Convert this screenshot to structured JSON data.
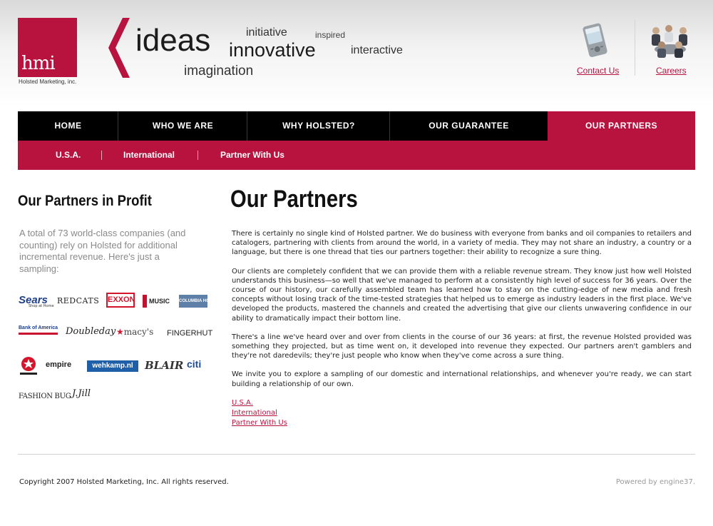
{
  "header": {
    "logo_text": "hmi",
    "logo_subtitle": "Holsted Marketing, inc.",
    "taglines": {
      "ideas": "ideas",
      "initiative": "initiative",
      "inspired": "inspired",
      "innovative": "innovative",
      "interactive": "interactive",
      "imagination": "imagination"
    },
    "contact_label": "Contact Us",
    "careers_label": "Careers"
  },
  "nav": {
    "items": [
      "HOME",
      "WHO WE ARE",
      "WHY HOLSTED?",
      "OUR GUARANTEE",
      "OUR PARTNERS"
    ],
    "active": "OUR PARTNERS"
  },
  "subnav": {
    "items": [
      "U.S.A.",
      "International",
      "Partner With Us"
    ]
  },
  "sidebar": {
    "title": "Our Partners in Profit",
    "text": "A total of 73 world-class companies (and counting) rely on Holsted for additional incremental revenue. Here's just a sampling:",
    "logos": [
      "Sears",
      "Shop at Home",
      "REDCATS",
      "EXXON",
      "MUSIC",
      "COLUMBIA HOUSE",
      "Bank of America",
      "Doubleday",
      "macy's",
      "FINGERHUT",
      "empire",
      "wehkamp.nl",
      "BLAIR",
      "citi",
      "FASHION BUG",
      "J.Jill"
    ]
  },
  "main": {
    "title": "Our Partners",
    "paragraphs": [
      "There is certainly no single kind of Holsted partner. We do business with everyone from banks and oil companies to retailers and catalogers, partnering with clients from around the world, in a variety of media. They may not share an industry, a country or a language, but there is one thread that ties our partners together: their ability to recognize a sure thing.",
      "Our clients are completely confident that we can provide them with a reliable revenue stream. They know just how well Holsted understands this business—so well that we've managed to perform at a consistently high level of success for 36 years. Over the course of our history, our carefully assembled team has learned how to stay on the cutting-edge of new media and fresh concepts without losing track of the time-tested strategies that helped us to emerge as industry leaders in the first place. We've developed the products, mastered the channels and created the advertising that give our clients unwavering confidence in our ability to dramatically impact their bottom line.",
      "There's a line we've heard over and over from clients in the course of our 36 years: at first, the revenue Holsted provided was something they projected, but as time went on, it developed into revenue they expected. Our partners aren't gamblers and they're not daredevils; they're just people who know when they've come across a sure thing.",
      "We invite you to explore a sampling of our domestic and international relationships, and whenever you're ready, we can start building a relationship of our own."
    ],
    "links": [
      "U.S.A.",
      "International",
      "Partner With Us"
    ]
  },
  "footer": {
    "copyright": "Copyright 2007 Holsted Marketing, Inc. All rights reserved.",
    "powered": "Powered by engine37."
  },
  "colors": {
    "brand": "#b8123e",
    "nav_bg": "#000000"
  }
}
